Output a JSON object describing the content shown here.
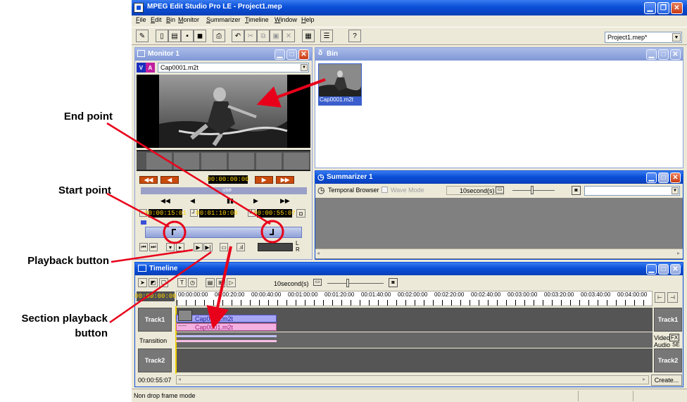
{
  "window": {
    "title": "MPEG Edit Studio Pro LE - Project1.mep",
    "menu": [
      "File",
      "Edit",
      "Bin",
      "Monitor",
      "Summarizer",
      "Timeline",
      "Window",
      "Help"
    ],
    "project_select": "Project1.mep*"
  },
  "monitor": {
    "title": "Monitor 1",
    "clip_select": "Cap0001.m2t",
    "transport_timecode": "00:00:00:00",
    "pause_label": "use",
    "in_timecode": "00:00:15:01",
    "duration_timecode": "00:01:10:08",
    "out_timecode": "00:00:55:07",
    "audio_l": "L",
    "audio_r": "R"
  },
  "bin": {
    "title": "Bin",
    "clip_label": "Cap0001.m2t"
  },
  "summarizer": {
    "title": "Summarizer 1",
    "temporal_browser": "Temporal Browser",
    "wave_mode": "Wave Mode",
    "interval": "10second(s)"
  },
  "timeline": {
    "title": "Timeline",
    "interval": "10second(s)",
    "current_time": "00:00:00:00",
    "ruler": [
      "00:00:00:00",
      "00:00:20:00",
      "00:00:40:00",
      "00:01:00:00",
      "00:01:20:00",
      "00:01:40:00",
      "00:02:00:00",
      "00:02:20:00",
      "00:02:40:00",
      "00:03:00:00",
      "00:03:20:00",
      "00:03:40:00",
      "00:04:00:00"
    ],
    "track1": "Track1",
    "transition": "Transition",
    "track2": "Track2",
    "video_clip": "Cap0001.m2t",
    "audio_clip": "Cap0001.m2t",
    "video_label": "Video",
    "audio_label": "Audio",
    "fx_label": "FX",
    "se_label": "SE",
    "duration": "00:00:55:07",
    "create_button": "Create..."
  },
  "status": {
    "mode": "Non drop frame mode"
  },
  "annotations": {
    "end_point": "End point",
    "start_point": "Start point",
    "playback_button": "Playback button",
    "section_playback_line1": "Section playback",
    "section_playback_line2": "button"
  },
  "colors": {
    "annotation_red": "#e8001a",
    "title_blue": "#0a4fd8",
    "inactive_title": "#8ea2da",
    "timecode_yellow": "#ffd200"
  }
}
